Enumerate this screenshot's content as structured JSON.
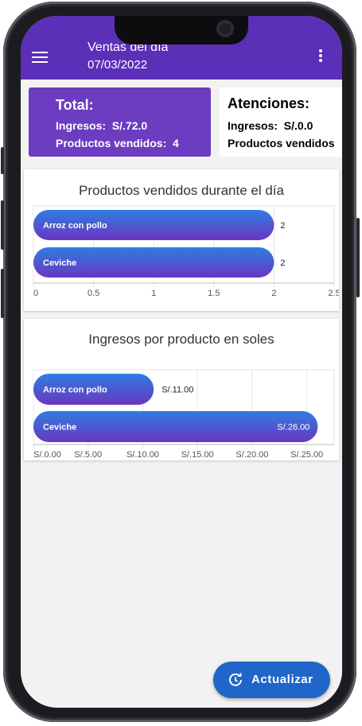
{
  "header": {
    "title": "Ventas del día",
    "date": "07/03/2022"
  },
  "total_card": {
    "heading": "Total:",
    "ingresos_label": "Ingresos:",
    "ingresos_value": "S/.72.0",
    "productos_label": "Productos vendidos:",
    "productos_value": "4"
  },
  "atenciones_card": {
    "heading": "Atenciones:",
    "ingresos_label": "Ingresos:",
    "ingresos_value": "S/.0.0",
    "productos_label": "Productos vendidos"
  },
  "chart_data": [
    {
      "type": "bar",
      "orientation": "horizontal",
      "title": "Productos vendidos durante el día",
      "categories": [
        "Arroz con pollo",
        "Ceviche"
      ],
      "values": [
        2,
        2
      ],
      "value_labels": [
        "2",
        "2"
      ],
      "xlim": [
        0,
        2.5
      ],
      "xticks": [
        "0",
        "0.5",
        "1",
        "1.5",
        "2",
        "2.5"
      ],
      "grid": true
    },
    {
      "type": "bar",
      "orientation": "horizontal",
      "title": "Ingresos por producto en soles",
      "categories": [
        "Arroz con pollo",
        "Ceviche"
      ],
      "values": [
        11,
        26
      ],
      "value_labels": [
        "S/.11.00",
        "S/.26.00"
      ],
      "xlim": [
        0,
        27.5
      ],
      "xticks": [
        "S/.0.00",
        "S/.5.00",
        "S/.10.00",
        "S/.15.00",
        "S/.20.00",
        "S/.25.00"
      ],
      "grid": true
    }
  ],
  "fab": {
    "label": "Actualizar",
    "icon": "refresh-clock-icon"
  },
  "colors": {
    "appbar": "#5b2fb8",
    "total_card": "#6c3cc1",
    "bar_start": "#2f7de1",
    "bar_end": "#6a36c0",
    "fab": "#1f66c8"
  }
}
